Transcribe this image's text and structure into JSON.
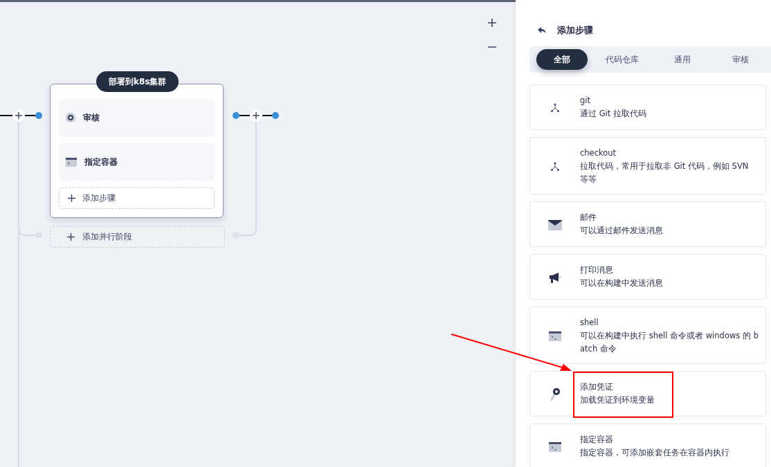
{
  "stage": {
    "title": "部署到k8s集群",
    "steps": [
      {
        "kind": "approval",
        "label": "审核"
      },
      {
        "kind": "container",
        "label": "指定容器"
      }
    ],
    "add_step": "添加步骤",
    "add_parallel": "添加并行阶段"
  },
  "panel": {
    "title": "添加步骤",
    "tabs": [
      {
        "label": "全部",
        "selected": true
      },
      {
        "label": "代码仓库",
        "selected": false
      },
      {
        "label": "通用",
        "selected": false
      },
      {
        "label": "审核",
        "selected": false
      }
    ],
    "items": [
      {
        "kind": "branch",
        "name": "git",
        "description": "通过 Git 拉取代码",
        "highlighted": false
      },
      {
        "kind": "branch",
        "name": "checkout",
        "description": "拉取代码，常用于拉取非 Git 代码，例如 SVN 等等",
        "highlighted": false
      },
      {
        "kind": "mail",
        "name": "邮件",
        "description": "可以通过邮件发送消息",
        "highlighted": false
      },
      {
        "kind": "megaphone",
        "name": "打印消息",
        "description": "可以在构建中发送消息",
        "highlighted": false
      },
      {
        "kind": "terminal",
        "name": "shell",
        "description": "可以在构建中执行 shell 命令或者 windows 的 batch 命令",
        "highlighted": false
      },
      {
        "kind": "key",
        "name": "添加凭证",
        "description": "加载凭证到环境变量",
        "highlighted": true
      },
      {
        "kind": "terminal",
        "name": "指定容器",
        "description": "指定容器，可添加嵌套任务在容器内执行",
        "highlighted": false
      }
    ]
  }
}
